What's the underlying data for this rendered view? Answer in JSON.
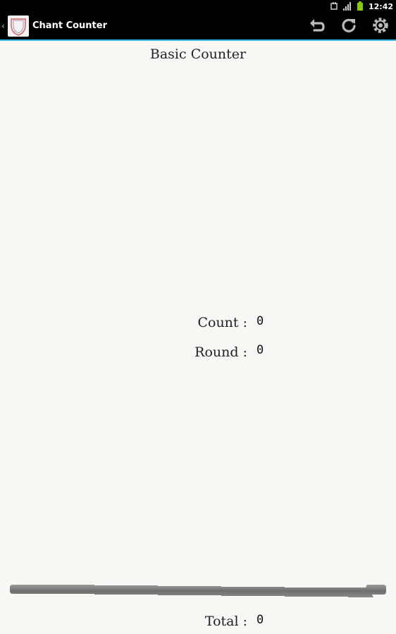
{
  "status_bar": {
    "time": "12:42"
  },
  "action_bar": {
    "title": "Chant Counter",
    "icons": {
      "up": "chevron-left-icon",
      "app": "app-shield-icon",
      "undo": "undo-icon",
      "reset": "refresh-icon",
      "settings": "settings-icon"
    }
  },
  "main": {
    "title": "Basic Counter",
    "count_label": "Count :",
    "count_value": "0",
    "round_label": "Round :",
    "round_value": "0",
    "total_label": "Total :",
    "total_value": "0"
  },
  "colors": {
    "background": "#f8f7f3",
    "action_bar": "#000000",
    "accent_line": "#33b5e5",
    "divider_bar": "#7a7a7a"
  }
}
